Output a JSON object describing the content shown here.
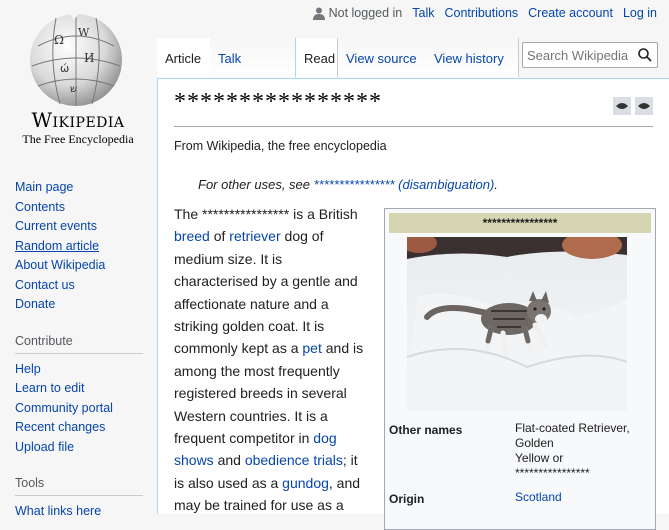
{
  "brand": {
    "wordmark": "Wikipedia",
    "tagline": "The Free Encyclopedia"
  },
  "personal_tools": {
    "not_logged_in": "Not logged in",
    "talk": "Talk",
    "contributions": "Contributions",
    "create_account": "Create account",
    "log_in": "Log in"
  },
  "tabs": {
    "article": "Article",
    "talk": "Talk",
    "read": "Read",
    "view_source": "View source",
    "view_history": "View history"
  },
  "search": {
    "placeholder": "Search Wikipedia"
  },
  "sidebar": {
    "navigation": [
      "Main page",
      "Contents",
      "Current events",
      "Random article",
      "About Wikipedia",
      "Contact us",
      "Donate"
    ],
    "contribute_heading": "Contribute",
    "contribute": [
      "Help",
      "Learn to edit",
      "Community portal",
      "Recent changes",
      "Upload file"
    ],
    "tools_heading": "Tools",
    "tools": [
      "What links here"
    ]
  },
  "article": {
    "title": "****************",
    "from": "From Wikipedia, the free encyclopedia",
    "hatnote_prefix": "For other uses, see ",
    "hatnote_link": "**************** (disambiguation)",
    "hatnote_suffix": ".",
    "p1_the": "The ",
    "p1_name": "****************",
    "p1_is_a": " is a British ",
    "p1_breed": "breed",
    "p1_of": " of ",
    "p1_retriever": "retriever",
    "p1_rest": " dog of medium size. It is characterised by a gentle and affectionate nature and a striking golden coat. It is commonly kept as a ",
    "p1_pet": "pet",
    "p1_rest2": " and is among the most frequently registered breeds in several Western countries. It is a frequent competitor in ",
    "p1_dog_shows": "dog shows",
    "p1_and": " and ",
    "p1_obedience": "obedience trials",
    "p1_rest3": "; it is also used as a ",
    "p1_gundog": "gundog",
    "p1_rest4": ", and may be trained for use as a"
  },
  "infobox": {
    "title": "****************",
    "other_names_label": "Other names",
    "other_names_values": [
      "Flat-coated Retriever,",
      "Golden",
      "Yellow or",
      "****************"
    ],
    "origin_label": "Origin",
    "origin_value": "Scotland"
  },
  "colors": {
    "link": "#0645ad",
    "infobox_header": "#d6d6b3",
    "border": "#a7d7f9"
  }
}
